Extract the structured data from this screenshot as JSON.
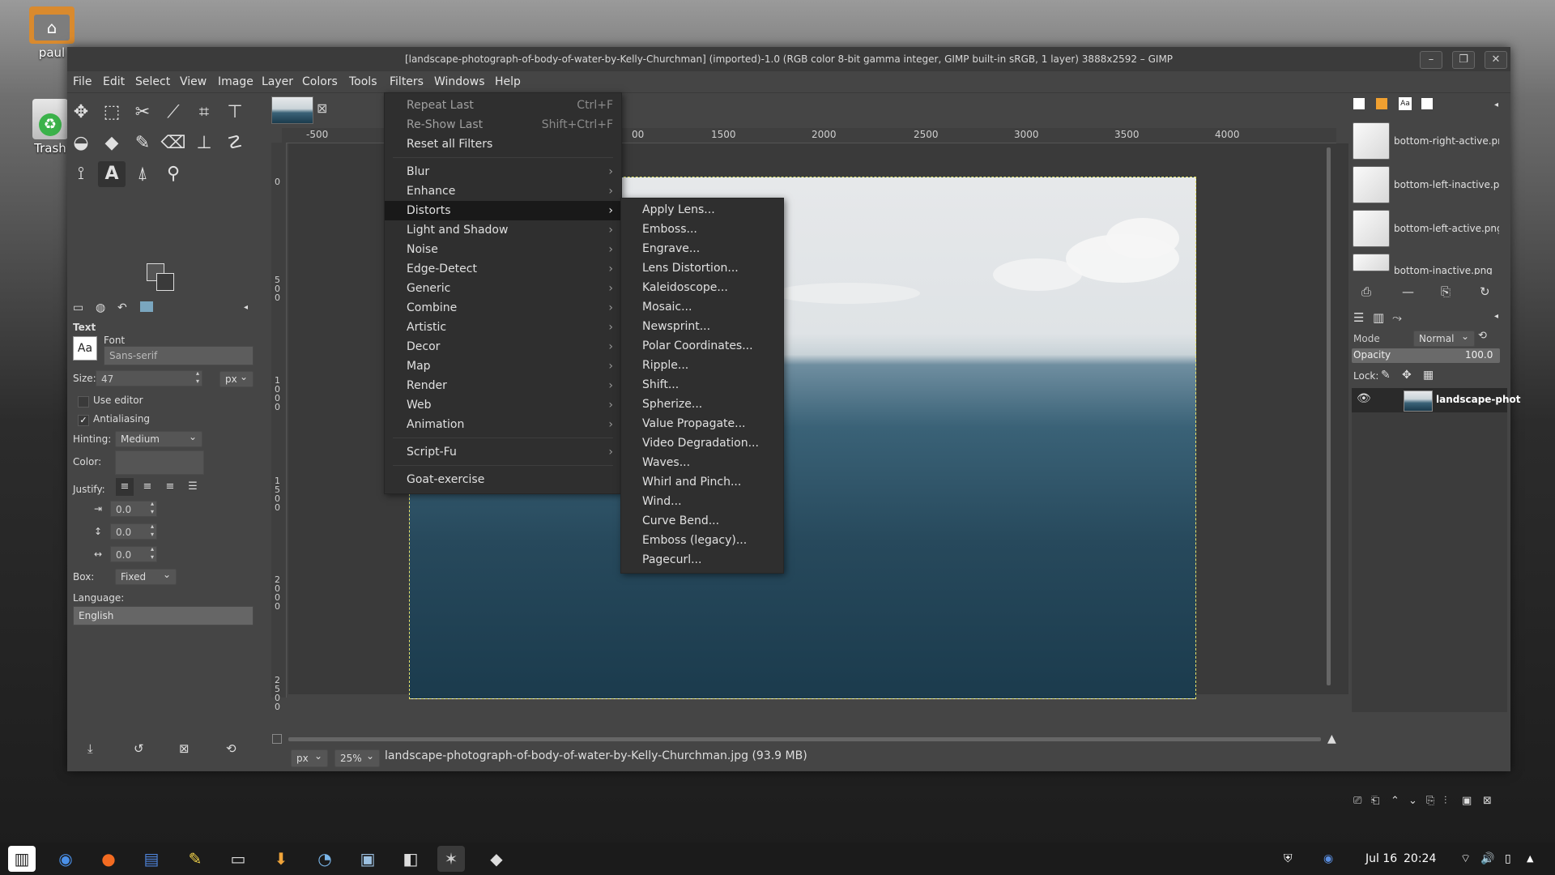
{
  "desktop": {
    "home_label": "paul",
    "trash_label": "Trash"
  },
  "window": {
    "title": "[landscape-photograph-of-body-of-water-by-Kelly-Churchman] (imported)-1.0 (RGB color 8-bit gamma integer, GIMP built-in sRGB, 1 layer) 3888x2592 – GIMP",
    "minimize": "–",
    "maximize": "❐",
    "close": "✕"
  },
  "menubar": [
    "File",
    "Edit",
    "Select",
    "View",
    "Image",
    "Layer",
    "Colors",
    "Tools",
    "Filters",
    "Windows",
    "Help"
  ],
  "filters_menu": {
    "repeat_last": "Repeat Last",
    "repeat_last_shortcut": "Ctrl+F",
    "reshow_last": "Re-Show Last",
    "reshow_last_shortcut": "Shift+Ctrl+F",
    "reset_all": "Reset all Filters",
    "submenus": [
      "Blur",
      "Enhance",
      "Distorts",
      "Light and Shadow",
      "Noise",
      "Edge-Detect",
      "Generic",
      "Combine",
      "Artistic",
      "Decor",
      "Map",
      "Render",
      "Web",
      "Animation"
    ],
    "script_fu": "Script-Fu",
    "goat": "Goat-exercise"
  },
  "distorts_menu": [
    "Apply Lens...",
    "Emboss...",
    "Engrave...",
    "Lens Distortion...",
    "Kaleidoscope...",
    "Mosaic...",
    "Newsprint...",
    "Polar Coordinates...",
    "Ripple...",
    "Shift...",
    "Spherize...",
    "Value Propagate...",
    "Video Degradation...",
    "Waves...",
    "Whirl and Pinch...",
    "Wind...",
    "Curve Bend...",
    "Emboss (legacy)...",
    "Pagecurl..."
  ],
  "tool_options": {
    "title": "Text",
    "font_label": "Font",
    "font_icon_text": "Aa",
    "font_value": "Sans-serif",
    "size_label": "Size:",
    "size_value": "47",
    "size_unit": "px",
    "use_editor": "Use editor",
    "antialiasing": "Antialiasing",
    "antialiasing_checked": "✓",
    "hinting_label": "Hinting:",
    "hinting_value": "Medium",
    "color_label": "Color:",
    "justify_label": "Justify:",
    "indent": "0.0",
    "line_spacing": "0.0",
    "letter_spacing": "0.0",
    "box_label": "Box:",
    "box_value": "Fixed",
    "language_label": "Language:",
    "language_value": "English"
  },
  "ruler": {
    "h_ticks": [
      "-500",
      "1500",
      "2000",
      "2500",
      "3000",
      "3500",
      "4000"
    ],
    "h_partial_tick": "00",
    "v_ticks": [
      "0",
      "500",
      "1000",
      "1500",
      "2000",
      "2500"
    ]
  },
  "statusbar": {
    "unit": "px",
    "zoom": "25%",
    "file_info": "landscape-photograph-of-body-of-water-by-Kelly-Churchman.jpg (93.9 MB)"
  },
  "brushes": {
    "items": [
      "bottom-right-active.png",
      "bottom-left-inactive.png",
      "bottom-left-active.png",
      "bottom-inactive.png"
    ],
    "tab_text_icon": "Aa"
  },
  "layers": {
    "mode_label": "Mode",
    "mode_value": "Normal",
    "opacity_label": "Opacity",
    "opacity_value": "100.0",
    "lock_label": "Lock:",
    "layer_name": "landscape-phot"
  },
  "taskbar": {
    "date": "Jul 16",
    "time": "20:24"
  }
}
